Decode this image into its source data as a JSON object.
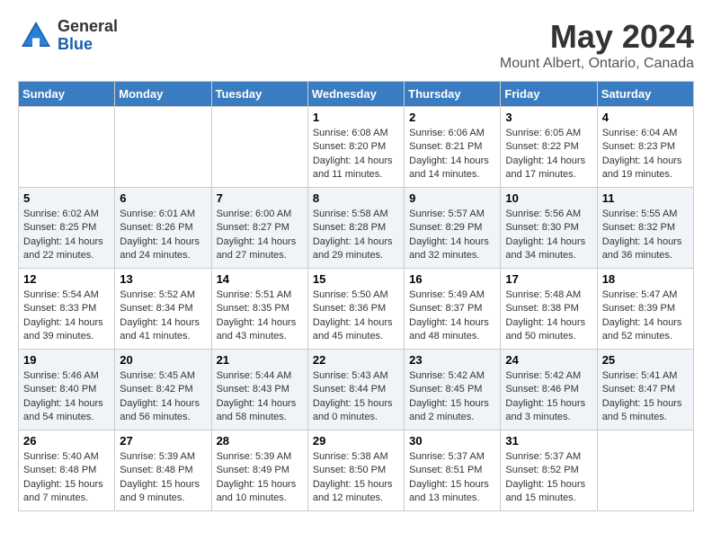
{
  "header": {
    "logo_general": "General",
    "logo_blue": "Blue",
    "month_title": "May 2024",
    "location": "Mount Albert, Ontario, Canada"
  },
  "days_of_week": [
    "Sunday",
    "Monday",
    "Tuesday",
    "Wednesday",
    "Thursday",
    "Friday",
    "Saturday"
  ],
  "weeks": [
    [
      {
        "day": "",
        "info": ""
      },
      {
        "day": "",
        "info": ""
      },
      {
        "day": "",
        "info": ""
      },
      {
        "day": "1",
        "sunrise": "Sunrise: 6:08 AM",
        "sunset": "Sunset: 8:20 PM",
        "daylight": "Daylight: 14 hours and 11 minutes."
      },
      {
        "day": "2",
        "sunrise": "Sunrise: 6:06 AM",
        "sunset": "Sunset: 8:21 PM",
        "daylight": "Daylight: 14 hours and 14 minutes."
      },
      {
        "day": "3",
        "sunrise": "Sunrise: 6:05 AM",
        "sunset": "Sunset: 8:22 PM",
        "daylight": "Daylight: 14 hours and 17 minutes."
      },
      {
        "day": "4",
        "sunrise": "Sunrise: 6:04 AM",
        "sunset": "Sunset: 8:23 PM",
        "daylight": "Daylight: 14 hours and 19 minutes."
      }
    ],
    [
      {
        "day": "5",
        "sunrise": "Sunrise: 6:02 AM",
        "sunset": "Sunset: 8:25 PM",
        "daylight": "Daylight: 14 hours and 22 minutes."
      },
      {
        "day": "6",
        "sunrise": "Sunrise: 6:01 AM",
        "sunset": "Sunset: 8:26 PM",
        "daylight": "Daylight: 14 hours and 24 minutes."
      },
      {
        "day": "7",
        "sunrise": "Sunrise: 6:00 AM",
        "sunset": "Sunset: 8:27 PM",
        "daylight": "Daylight: 14 hours and 27 minutes."
      },
      {
        "day": "8",
        "sunrise": "Sunrise: 5:58 AM",
        "sunset": "Sunset: 8:28 PM",
        "daylight": "Daylight: 14 hours and 29 minutes."
      },
      {
        "day": "9",
        "sunrise": "Sunrise: 5:57 AM",
        "sunset": "Sunset: 8:29 PM",
        "daylight": "Daylight: 14 hours and 32 minutes."
      },
      {
        "day": "10",
        "sunrise": "Sunrise: 5:56 AM",
        "sunset": "Sunset: 8:30 PM",
        "daylight": "Daylight: 14 hours and 34 minutes."
      },
      {
        "day": "11",
        "sunrise": "Sunrise: 5:55 AM",
        "sunset": "Sunset: 8:32 PM",
        "daylight": "Daylight: 14 hours and 36 minutes."
      }
    ],
    [
      {
        "day": "12",
        "sunrise": "Sunrise: 5:54 AM",
        "sunset": "Sunset: 8:33 PM",
        "daylight": "Daylight: 14 hours and 39 minutes."
      },
      {
        "day": "13",
        "sunrise": "Sunrise: 5:52 AM",
        "sunset": "Sunset: 8:34 PM",
        "daylight": "Daylight: 14 hours and 41 minutes."
      },
      {
        "day": "14",
        "sunrise": "Sunrise: 5:51 AM",
        "sunset": "Sunset: 8:35 PM",
        "daylight": "Daylight: 14 hours and 43 minutes."
      },
      {
        "day": "15",
        "sunrise": "Sunrise: 5:50 AM",
        "sunset": "Sunset: 8:36 PM",
        "daylight": "Daylight: 14 hours and 45 minutes."
      },
      {
        "day": "16",
        "sunrise": "Sunrise: 5:49 AM",
        "sunset": "Sunset: 8:37 PM",
        "daylight": "Daylight: 14 hours and 48 minutes."
      },
      {
        "day": "17",
        "sunrise": "Sunrise: 5:48 AM",
        "sunset": "Sunset: 8:38 PM",
        "daylight": "Daylight: 14 hours and 50 minutes."
      },
      {
        "day": "18",
        "sunrise": "Sunrise: 5:47 AM",
        "sunset": "Sunset: 8:39 PM",
        "daylight": "Daylight: 14 hours and 52 minutes."
      }
    ],
    [
      {
        "day": "19",
        "sunrise": "Sunrise: 5:46 AM",
        "sunset": "Sunset: 8:40 PM",
        "daylight": "Daylight: 14 hours and 54 minutes."
      },
      {
        "day": "20",
        "sunrise": "Sunrise: 5:45 AM",
        "sunset": "Sunset: 8:42 PM",
        "daylight": "Daylight: 14 hours and 56 minutes."
      },
      {
        "day": "21",
        "sunrise": "Sunrise: 5:44 AM",
        "sunset": "Sunset: 8:43 PM",
        "daylight": "Daylight: 14 hours and 58 minutes."
      },
      {
        "day": "22",
        "sunrise": "Sunrise: 5:43 AM",
        "sunset": "Sunset: 8:44 PM",
        "daylight": "Daylight: 15 hours and 0 minutes."
      },
      {
        "day": "23",
        "sunrise": "Sunrise: 5:42 AM",
        "sunset": "Sunset: 8:45 PM",
        "daylight": "Daylight: 15 hours and 2 minutes."
      },
      {
        "day": "24",
        "sunrise": "Sunrise: 5:42 AM",
        "sunset": "Sunset: 8:46 PM",
        "daylight": "Daylight: 15 hours and 3 minutes."
      },
      {
        "day": "25",
        "sunrise": "Sunrise: 5:41 AM",
        "sunset": "Sunset: 8:47 PM",
        "daylight": "Daylight: 15 hours and 5 minutes."
      }
    ],
    [
      {
        "day": "26",
        "sunrise": "Sunrise: 5:40 AM",
        "sunset": "Sunset: 8:48 PM",
        "daylight": "Daylight: 15 hours and 7 minutes."
      },
      {
        "day": "27",
        "sunrise": "Sunrise: 5:39 AM",
        "sunset": "Sunset: 8:48 PM",
        "daylight": "Daylight: 15 hours and 9 minutes."
      },
      {
        "day": "28",
        "sunrise": "Sunrise: 5:39 AM",
        "sunset": "Sunset: 8:49 PM",
        "daylight": "Daylight: 15 hours and 10 minutes."
      },
      {
        "day": "29",
        "sunrise": "Sunrise: 5:38 AM",
        "sunset": "Sunset: 8:50 PM",
        "daylight": "Daylight: 15 hours and 12 minutes."
      },
      {
        "day": "30",
        "sunrise": "Sunrise: 5:37 AM",
        "sunset": "Sunset: 8:51 PM",
        "daylight": "Daylight: 15 hours and 13 minutes."
      },
      {
        "day": "31",
        "sunrise": "Sunrise: 5:37 AM",
        "sunset": "Sunset: 8:52 PM",
        "daylight": "Daylight: 15 hours and 15 minutes."
      },
      {
        "day": "",
        "info": ""
      }
    ]
  ]
}
